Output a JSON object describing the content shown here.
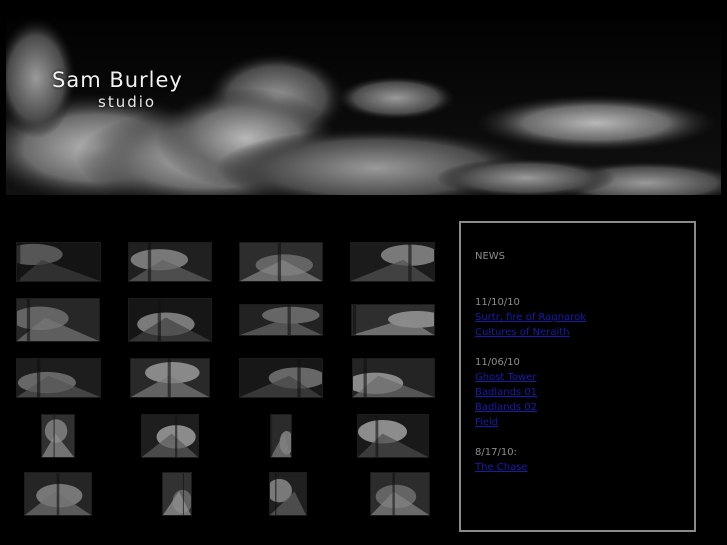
{
  "header": {
    "brand_name": "Sam Burley",
    "brand_sub": "studio"
  },
  "gallery": {
    "thumbnails": [
      {
        "name": "artwork-thumbnail"
      },
      {
        "name": "artwork-thumbnail"
      },
      {
        "name": "artwork-thumbnail"
      },
      {
        "name": "artwork-thumbnail"
      },
      {
        "name": "artwork-thumbnail"
      },
      {
        "name": "artwork-thumbnail"
      },
      {
        "name": "artwork-thumbnail"
      },
      {
        "name": "artwork-thumbnail"
      },
      {
        "name": "artwork-thumbnail"
      },
      {
        "name": "artwork-thumbnail"
      },
      {
        "name": "artwork-thumbnail"
      },
      {
        "name": "artwork-thumbnail"
      },
      {
        "name": "artwork-thumbnail"
      },
      {
        "name": "artwork-thumbnail"
      },
      {
        "name": "artwork-thumbnail"
      },
      {
        "name": "artwork-thumbnail"
      },
      {
        "name": "artwork-thumbnail"
      },
      {
        "name": "artwork-thumbnail"
      },
      {
        "name": "artwork-thumbnail"
      },
      {
        "name": "artwork-thumbnail"
      }
    ]
  },
  "news": {
    "title": "NEWS",
    "groups": [
      {
        "date": "11/10/10",
        "links": [
          "Surtr, fire of Ragnarok",
          "Cultures of Neraith"
        ]
      },
      {
        "date": "11/06/10",
        "links": [
          "Ghost Tower",
          "Badlands 01",
          "Badlands 02",
          "Field"
        ]
      },
      {
        "date": "8/17/10:",
        "links": [
          "The Chase"
        ]
      }
    ]
  },
  "colors": {
    "background": "#000000",
    "link": "#1a1aa8",
    "muted_text": "#8c8c8c",
    "panel_border": "#8a8a8a"
  }
}
